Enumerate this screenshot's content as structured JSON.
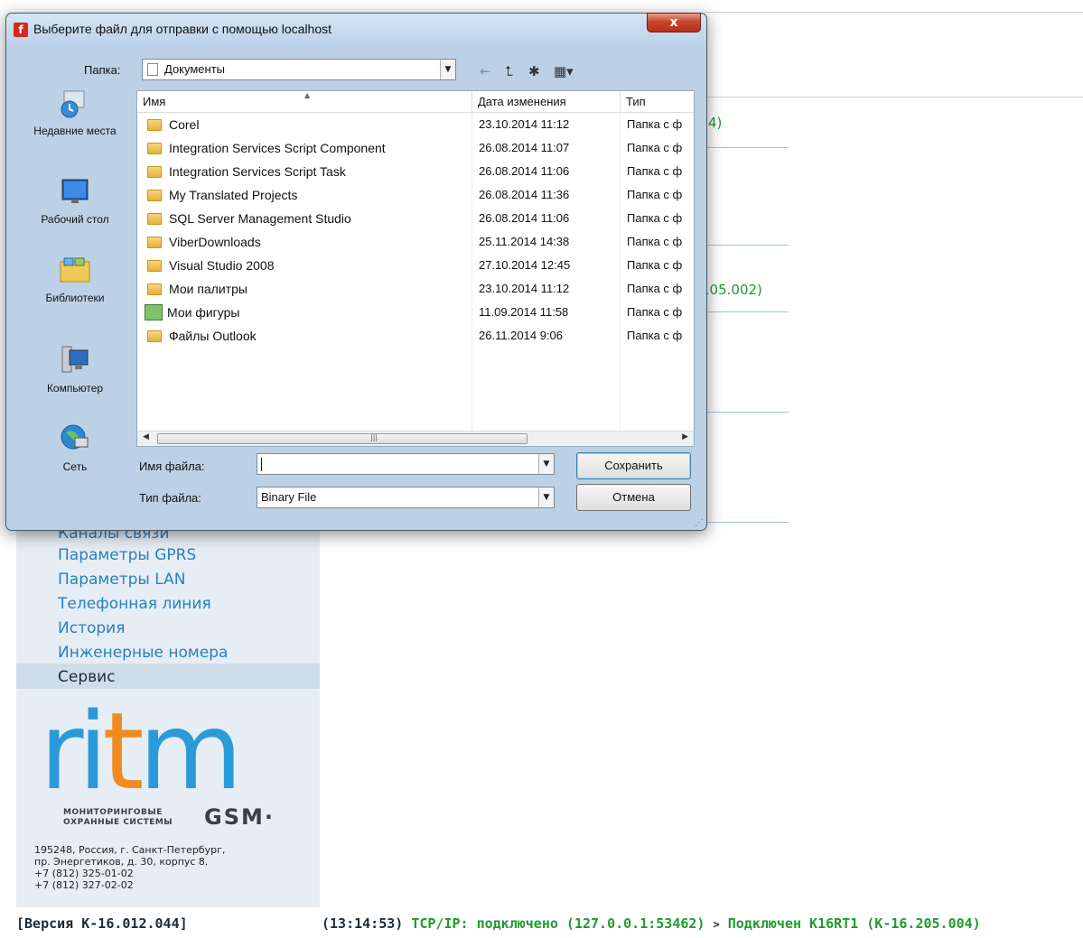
{
  "dialog": {
    "title": "Выберите файл для отправки с помощью localhost",
    "close_label": "x",
    "folder_label": "Папка:",
    "folder_value": "Документы",
    "places": [
      {
        "label": "Недавние места",
        "icon": "recent-places-icon"
      },
      {
        "label": "Рабочий стол",
        "icon": "desktop-icon"
      },
      {
        "label": "Библиотеки",
        "icon": "libraries-icon"
      },
      {
        "label": "Компьютер",
        "icon": "computer-icon"
      },
      {
        "label": "Сеть",
        "icon": "network-icon"
      }
    ],
    "columns": {
      "name": "Имя",
      "date": "Дата изменения",
      "type": "Тип"
    },
    "files": [
      {
        "name": "Corel",
        "date": "23.10.2014 11:12",
        "type": "Папка с ф"
      },
      {
        "name": "Integration Services Script Component",
        "date": "26.08.2014 11:07",
        "type": "Папка с ф"
      },
      {
        "name": "Integration Services Script Task",
        "date": "26.08.2014 11:06",
        "type": "Папка с ф"
      },
      {
        "name": "My Translated Projects",
        "date": "26.08.2014 11:36",
        "type": "Папка с ф"
      },
      {
        "name": "SQL Server Management Studio",
        "date": "26.08.2014 11:06",
        "type": "Папка с ф"
      },
      {
        "name": "ViberDownloads",
        "date": "25.11.2014 14:38",
        "type": "Папка с ф"
      },
      {
        "name": "Visual Studio 2008",
        "date": "27.10.2014 12:45",
        "type": "Папка с ф"
      },
      {
        "name": "Мои палитры",
        "date": "23.10.2014 11:12",
        "type": "Папка с ф"
      },
      {
        "name": "Мои фигуры",
        "date": "11.09.2014 11:58",
        "type": "Папка с ф"
      },
      {
        "name": "Файлы Outlook",
        "date": "26.11.2014 9:06",
        "type": "Папка с ф"
      }
    ],
    "filename_label": "Имя файла:",
    "filename_value": "",
    "filetype_label": "Тип файла:",
    "filetype_value": "Binary File",
    "save_label": "Сохранить",
    "cancel_label": "Отмена"
  },
  "background": {
    "frag1": "4)",
    "frag2": "105.002)",
    "partial_item": "Каналы связи"
  },
  "sidebar": {
    "items": [
      {
        "label": "Параметры GPRS",
        "active": false
      },
      {
        "label": "Параметры LAN",
        "active": false
      },
      {
        "label": "Телефонная линия",
        "active": false
      },
      {
        "label": "История",
        "active": false
      },
      {
        "label": "Инженерные номера",
        "active": false
      },
      {
        "label": "Сервис",
        "active": true
      }
    ],
    "logo": {
      "brand": "ritm",
      "sub1": "МОНИТОРИНГОВЫЕ",
      "sub2": "ОХРАННЫЕ СИСТЕМЫ",
      "gsm": "GSM·"
    },
    "address": "195248, Россия, г. Санкт-Петербург,\nпр. Энергетиков, д. 30, корпус 8.\n+7 (812) 325-01-02\n+7 (812) 327-02-02"
  },
  "footer": {
    "version": "[Версия К-16.012.044]",
    "time": "(13:14:53)",
    "tcp": "TCP/IP: подключено (127.0.0.1:53462)",
    "arrow": ">",
    "connected": "Подключен K16RT1 (К-16.205.004)"
  },
  "colors": {
    "accent_blue": "#2a7fbf",
    "status_green": "#1f9b2e",
    "logo_orange": "#f28a1f"
  }
}
